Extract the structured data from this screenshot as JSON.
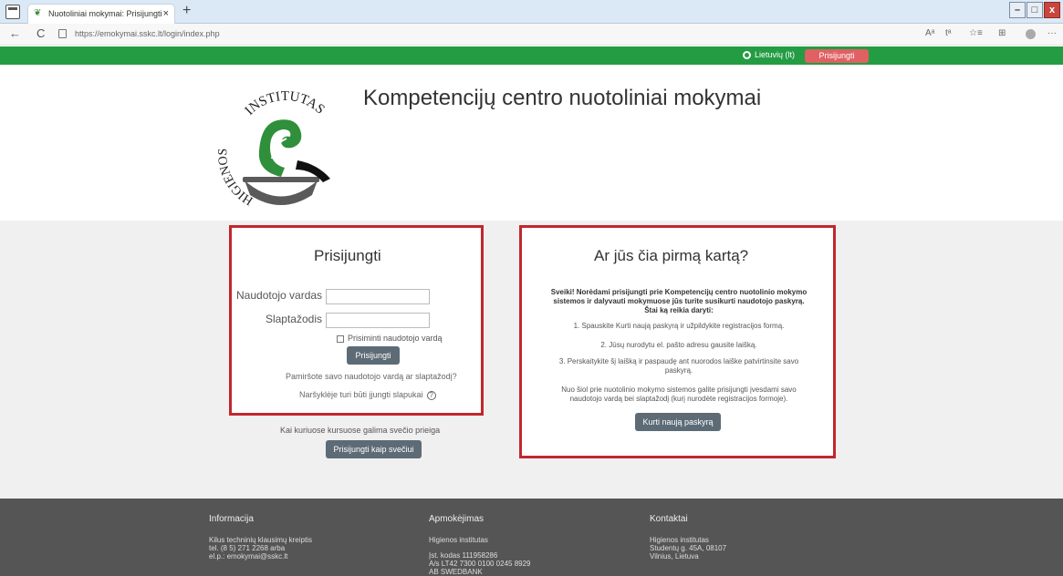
{
  "browser": {
    "tab_title": "Nuotoliniai mokymai: Prisijungti",
    "tab_close": "×",
    "new_tab": "+",
    "window_buttons": [
      "–",
      "□",
      "x"
    ],
    "url": "https://emokymai.sskc.lt/login/index.php",
    "nav_back": "←",
    "nav_refresh": "C",
    "tools": [
      "Aᵃ",
      "tᵃ",
      "☆≡",
      "⊞",
      "···"
    ]
  },
  "topnav": {
    "language": "Lietuvių (lt)",
    "login_button": "Prisijungti"
  },
  "header": {
    "title": "Kompetencijų centro nuotoliniai mokymai",
    "logo_text_top": "INSTITUTAS",
    "logo_text_left": "HIGIENOS"
  },
  "login": {
    "heading": "Prisijungti",
    "username_label": "Naudotojo vardas",
    "username_value": "",
    "password_label": "Slaptažodis",
    "password_value": "",
    "remember_label": "Prisiminti naudotojo vardą",
    "submit": "Prisijungti",
    "forgot": "Pamiršote savo naudotojo vardą ar slaptažodį?",
    "cookies": "Naršyklėje turi būti įjungti slapukai",
    "cookies_help": "?"
  },
  "guest": {
    "note": "Kai kuriuose kursuose galima svečio prieiga",
    "button": "Prisijungti kaip svečiui"
  },
  "signup": {
    "heading": "Ar jūs čia pirmą kartą?",
    "intro": [
      "Sveiki! Norėdami prisijungti prie Kompetencijų centro nuotolinio mokymo",
      "sistemos ir dalyvauti mokymuose jūs turite susikurti naudotojo paskyrą.",
      "Štai ką reikia daryti:"
    ],
    "step1": "1. Spauskite Kurti naują paskyrą ir užpildykite registracijos formą.",
    "step2": "2. Jūsų nurodytu el. pašto adresu gausite laišką.",
    "step3a": "3. Perskaitykite šį laišką ir paspaudę ant nuorodos laiške patvirtinsite savo",
    "step3b": "paskyrą.",
    "outro_a": "Nuo šiol prie nuotolinio mokymo sistemos galite prisijungti įvesdami savo",
    "outro_b": "naudotojo vardą bei slaptažodį (kurį nurodėte registracijos formoje).",
    "button": "Kurti naują paskyrą"
  },
  "footer": {
    "info": {
      "heading": "Informacija",
      "lines": [
        "Kilus techninių klausimų kreiptis",
        "tel. (8 5) 271 2268 arba",
        "el.p.: emokymai@sskc.lt"
      ]
    },
    "payment": {
      "heading": "Apmokėjimas",
      "line1": "Higienos institutas",
      "lines": [
        "Įst. kodas 111958286",
        "A/s LT42 7300 0100 0245 8929",
        "AB SWEDBANK"
      ]
    },
    "contacts": {
      "heading": "Kontaktai",
      "lines": [
        "Higienos institutas",
        "Studentų g. 45A, 08107",
        "Vilnius, Lietuva"
      ]
    }
  }
}
